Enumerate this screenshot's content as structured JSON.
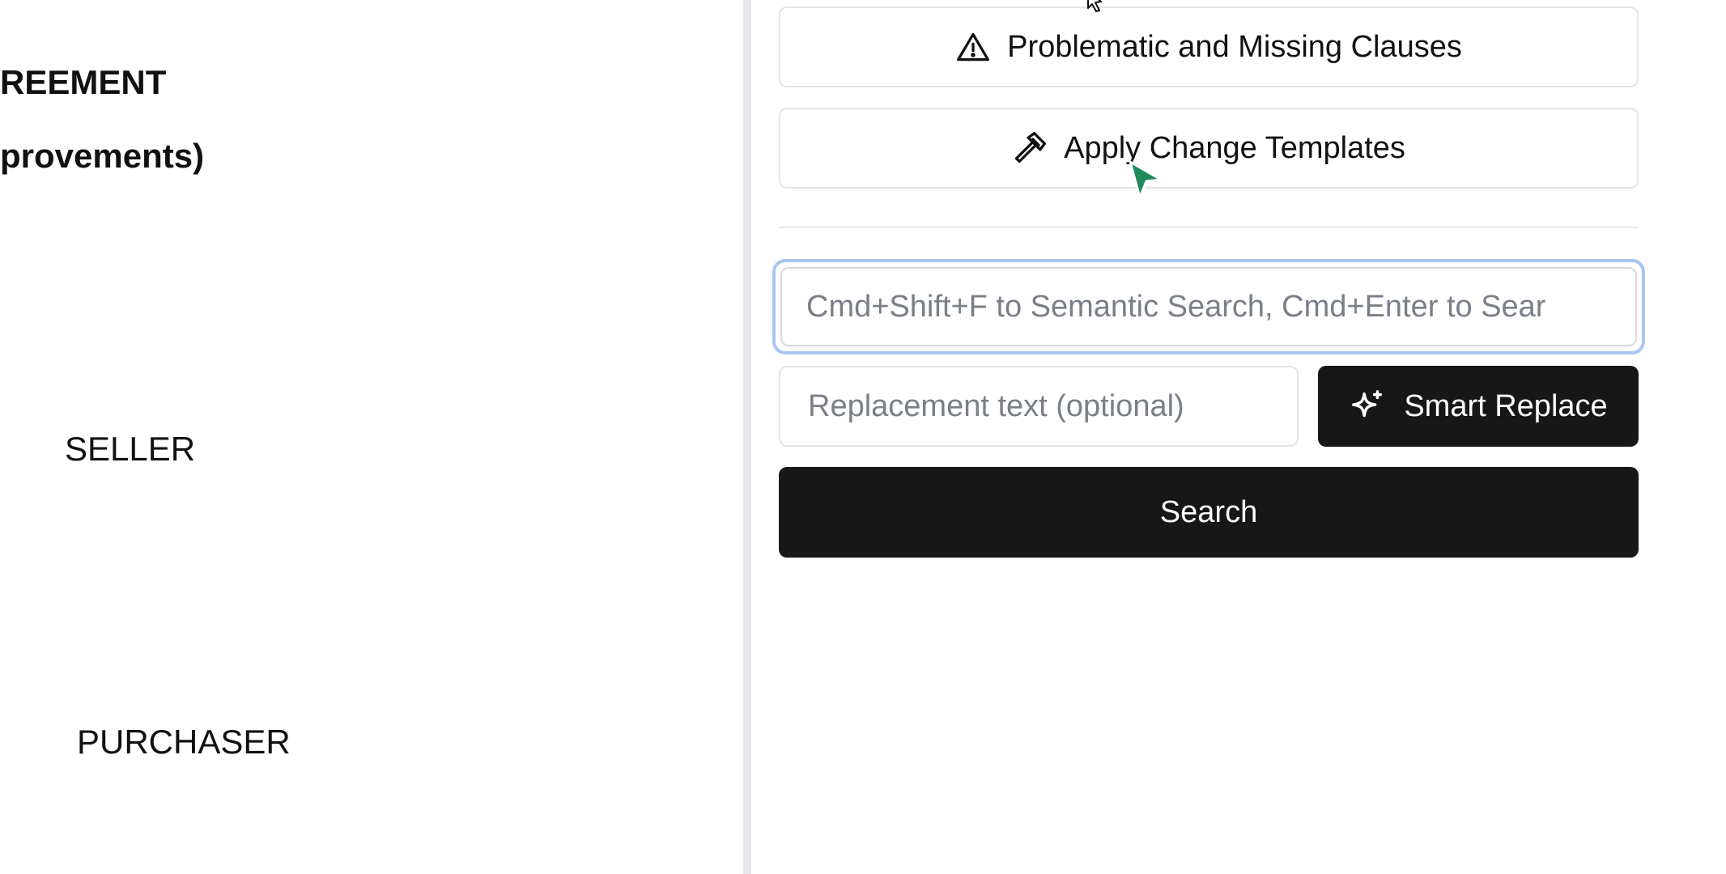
{
  "document": {
    "title_line1": "REEMENT",
    "title_line2": "provements)",
    "seller_label": "SELLER",
    "purchaser_label": "PURCHASER"
  },
  "panel": {
    "problematic_button": {
      "label": "Problematic and Missing Clauses",
      "icon": "warning-triangle-icon"
    },
    "apply_button": {
      "label": "Apply Change Templates",
      "icon": "hammer-icon"
    },
    "search": {
      "placeholder": "Cmd+Shift+F to Semantic Search, Cmd+Enter to Sear",
      "value": ""
    },
    "replacement": {
      "placeholder": "Replacement text (optional)",
      "value": ""
    },
    "smart_replace_button": {
      "label": "Smart Replace",
      "icon": "sparkles-icon"
    },
    "search_button": {
      "label": "Search"
    }
  },
  "colors": {
    "primary_button_bg": "#171717",
    "focus_ring": "#a9c6f2",
    "cursor": "#1f8a5b"
  }
}
